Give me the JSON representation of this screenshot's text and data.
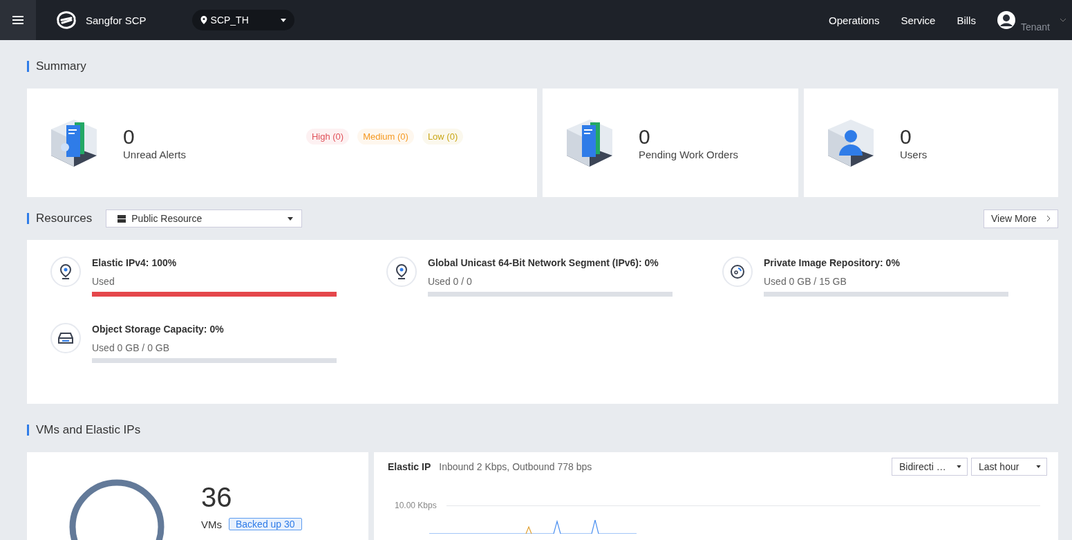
{
  "topbar": {
    "brand": "Sangfor SCP",
    "region": "SCP_TH",
    "nav": [
      "Operations",
      "Service",
      "Bills"
    ],
    "user_role": "Tenant"
  },
  "summary": {
    "title": "Summary",
    "cards": [
      {
        "kind": "alerts",
        "count": "0",
        "label": "Unread Alerts",
        "badges": [
          {
            "label": "High (0)",
            "color": "#e0525a"
          },
          {
            "label": "Medium (0)",
            "color": "#f59a23"
          },
          {
            "label": "Low (0)",
            "color": "#c9a616"
          }
        ]
      },
      {
        "kind": "orders",
        "count": "0",
        "label": "Pending Work Orders"
      },
      {
        "kind": "users",
        "count": "0",
        "label": "Users"
      }
    ]
  },
  "resources": {
    "title": "Resources",
    "filter": "Public Resource",
    "view_more": "View More",
    "items": [
      {
        "kind": "pin",
        "title": "Elastic IPv4: 100%",
        "used": "Used",
        "level": 1
      },
      {
        "kind": "pin",
        "title": "Global Unicast 64-Bit Network Segment (IPv6): 0%",
        "used": "Used 0 / 0",
        "level": 0
      },
      {
        "kind": "disc",
        "title": "Private Image Repository: 0%",
        "used": "Used 0 GB / 15 GB",
        "level": 0
      },
      {
        "kind": "drive",
        "title": "Object Storage Capacity: 0%",
        "used": "Used 0 GB / 0 GB",
        "level": 0
      }
    ]
  },
  "vms": {
    "title": "VMs and Elastic IPs",
    "count": "36",
    "label": "VMs",
    "backup": "Backed up 30",
    "eip": {
      "title": "Elastic IP",
      "summary": "Inbound 2 Kbps, Outbound 778 bps",
      "direction": "Bidirecti …",
      "range": "Last hour",
      "axis_label": "10.00 Kbps"
    }
  }
}
